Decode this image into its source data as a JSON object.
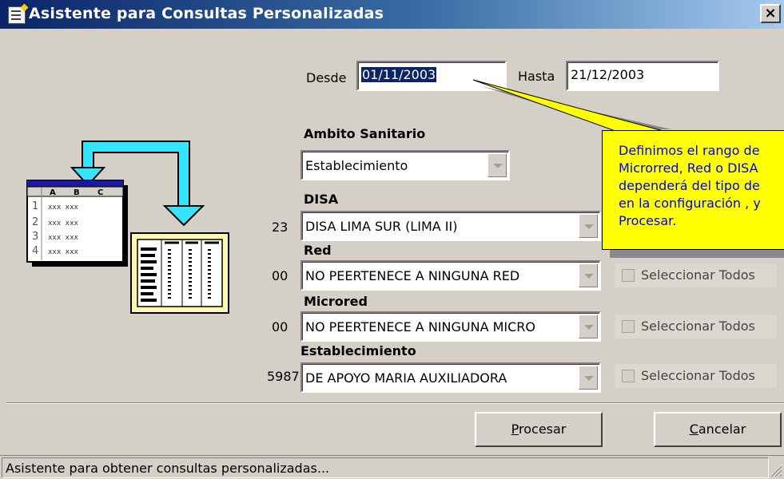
{
  "window": {
    "title": "Asistente para Consultas Personalizadas",
    "close_label": "×"
  },
  "dates": {
    "desde_label": "Desde",
    "desde_value": "01/11/2003",
    "hasta_label": "Hasta",
    "hasta_value": "21/12/2003"
  },
  "ambito": {
    "label": "Ambito Sanitario",
    "value": "Establecimiento"
  },
  "disa": {
    "label": "DISA",
    "code": "23",
    "value": "DISA LIMA SUR (LIMA II)"
  },
  "red": {
    "label": "Red",
    "code": "00",
    "value": "NO PEERTENECE A NINGUNA RED",
    "checkbox_label": "Seleccionar Todos"
  },
  "microred": {
    "label": "Microred",
    "code": "00",
    "value": "NO PEERTENECE A NINGUNA MICRO",
    "checkbox_label": "Seleccionar Todos"
  },
  "establecimiento": {
    "label": "Establecimiento",
    "code": "5987",
    "value": "DE APOYO MARIA AUXILIADORA",
    "checkbox_label": "Seleccionar Todos"
  },
  "illustration": {
    "rows": [
      "1",
      "2",
      "3",
      "4"
    ],
    "cols": [
      "A",
      "B",
      "C"
    ],
    "cell_text": "xxx xxx"
  },
  "callout": {
    "lines": [
      "Definimos el rango de",
      "Microrred, Red o DISA",
      "dependerá del tipo de",
      "en la configuración , y",
      "Procesar."
    ]
  },
  "buttons": {
    "procesar": "Procesar",
    "procesar_mnemonic": "P",
    "procesar_rest": "rocesar",
    "cancelar": "Cancelar",
    "cancelar_mnemonic": "C",
    "cancelar_rest": "ancelar"
  },
  "status": {
    "text": "Asistente para obtener consultas personalizadas..."
  },
  "colors": {
    "title_start": "#0a246a",
    "title_end": "#a6caf0",
    "callout_bg": "#ffff00",
    "callout_text": "#0000ff",
    "arrow": "#33e5ff"
  }
}
